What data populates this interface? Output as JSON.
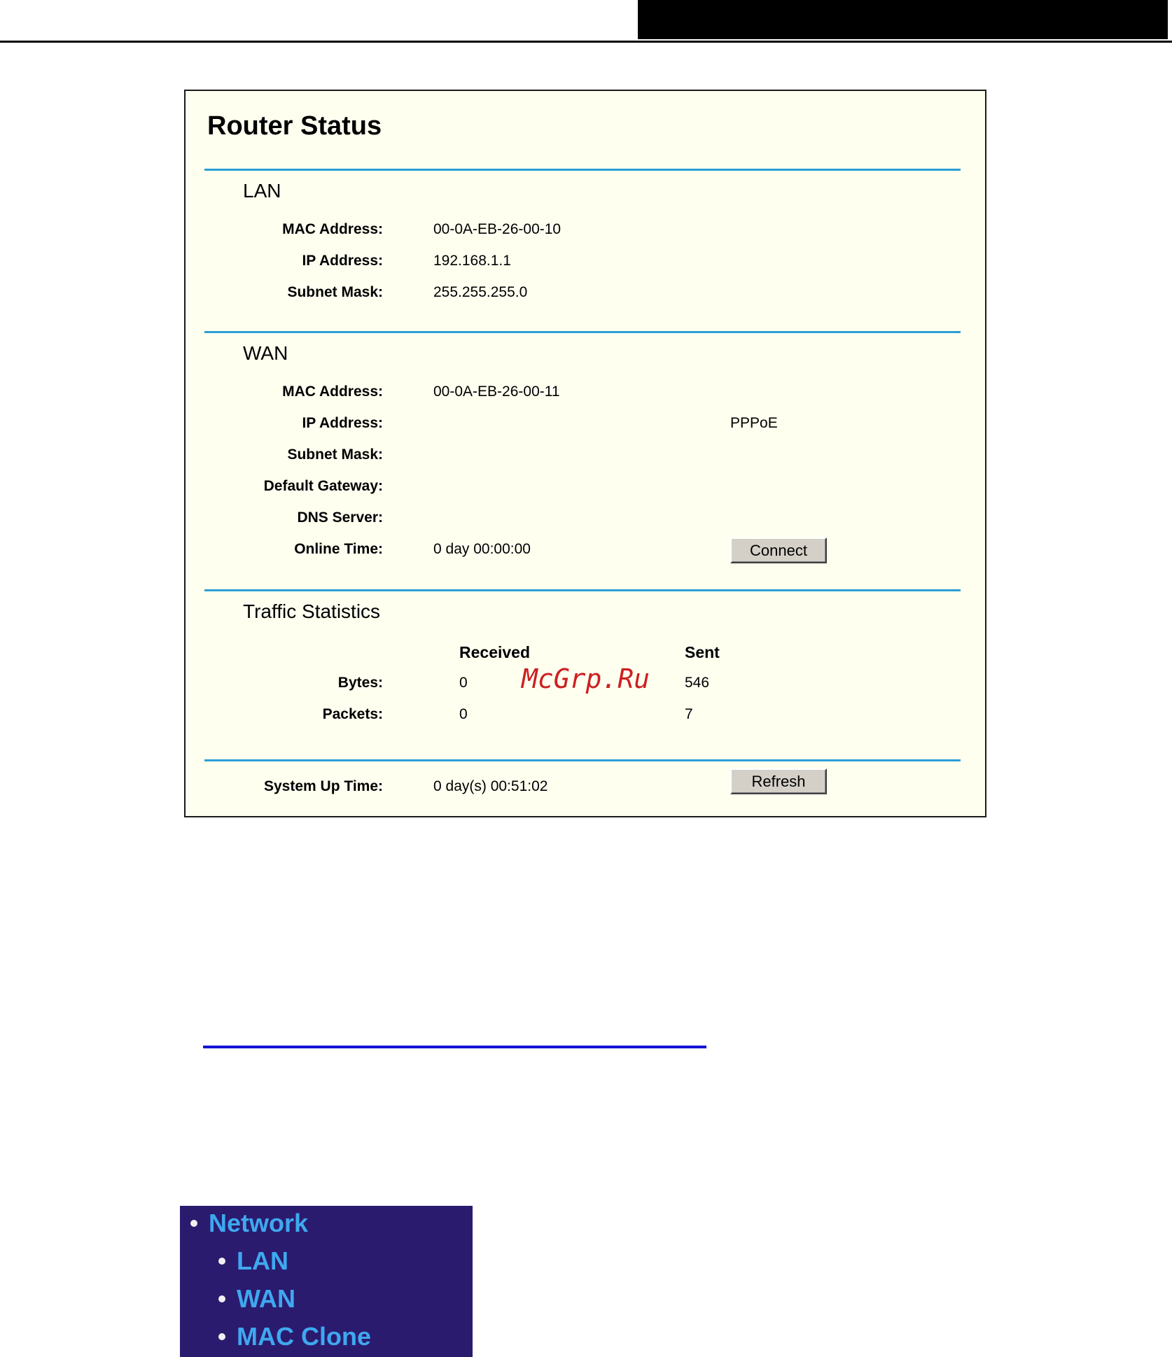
{
  "router_status": {
    "title": "Router Status",
    "lan": {
      "heading": "LAN",
      "fields": [
        {
          "label": "MAC Address:",
          "value": "00-0A-EB-26-00-10"
        },
        {
          "label": "IP Address:",
          "value": "192.168.1.1"
        },
        {
          "label": "Subnet Mask:",
          "value": "255.255.255.0"
        }
      ]
    },
    "wan": {
      "heading": "WAN",
      "mac_label": "MAC Address:",
      "mac_value": "00-0A-EB-26-00-11",
      "ip_label": "IP Address:",
      "ip_value": "",
      "connection_type": "PPPoE",
      "subnet_label": "Subnet Mask:",
      "subnet_value": "",
      "gateway_label": "Default Gateway:",
      "gateway_value": "",
      "dns_label": "DNS Server:",
      "dns_value": "",
      "online_label": "Online Time:",
      "online_value": "0 day 00:00:00",
      "connect_button": "Connect"
    },
    "traffic": {
      "heading": "Traffic Statistics",
      "col_received": "Received",
      "col_sent": "Sent",
      "rows": [
        {
          "label": "Bytes:",
          "received": "0",
          "sent": "546"
        },
        {
          "label": "Packets:",
          "received": "0",
          "sent": "7"
        }
      ]
    },
    "system": {
      "uptime_label": "System Up Time:",
      "uptime_value": "0 day(s) 00:51:02",
      "refresh_button": "Refresh"
    }
  },
  "watermark": "McGrp.Ru",
  "nav_menu": {
    "items": [
      {
        "label": "Network",
        "level": 0
      },
      {
        "label": "LAN",
        "level": 1
      },
      {
        "label": "WAN",
        "level": 1
      },
      {
        "label": "MAC Clone",
        "level": 1
      }
    ]
  },
  "colors": {
    "panel_background": "#fffff0",
    "section_rule": "#2a9fd6",
    "watermark": "#cc2020",
    "link_underline": "#1414d6",
    "menu_background": "#2a1b6e",
    "menu_text": "#3fa8ef"
  }
}
